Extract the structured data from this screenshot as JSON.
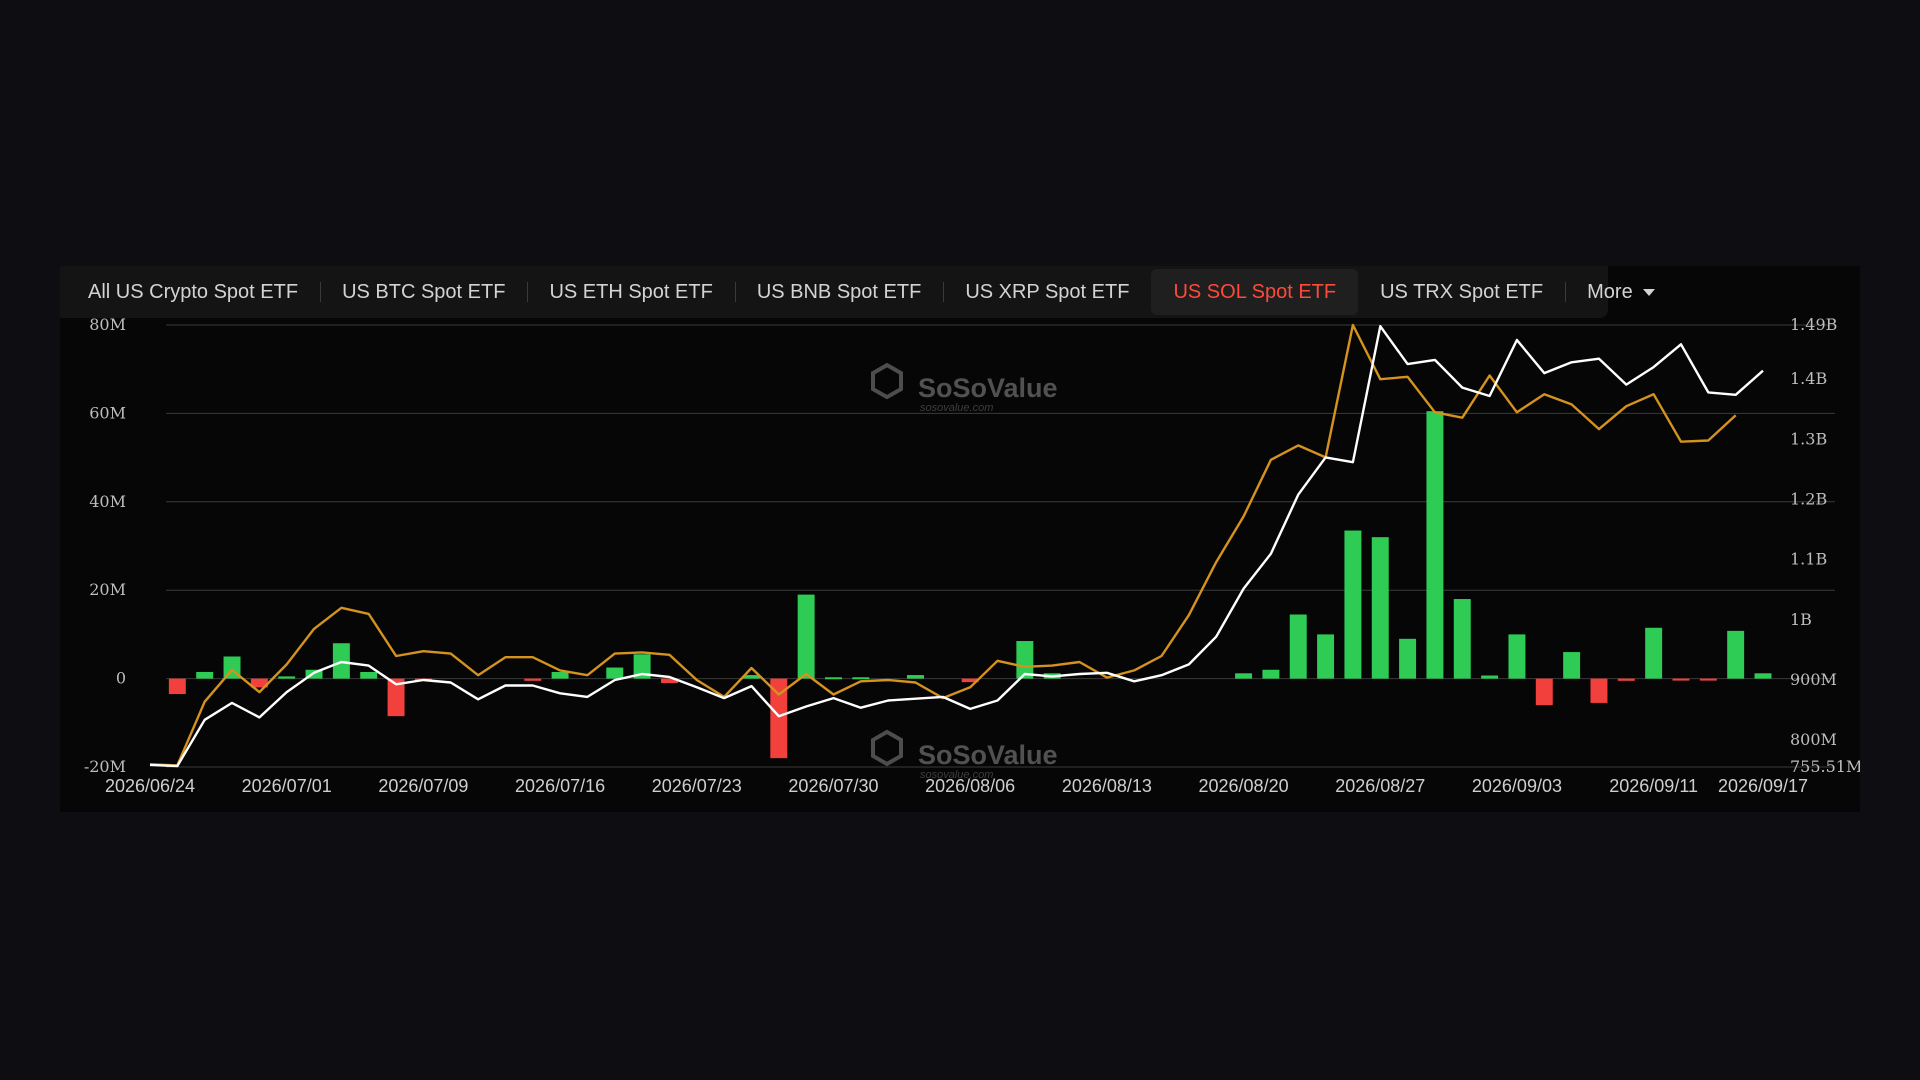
{
  "tabs": [
    {
      "label": "All US Crypto Spot ETF",
      "active": false
    },
    {
      "label": "US BTC Spot ETF",
      "active": false
    },
    {
      "label": "US ETH Spot ETF",
      "active": false
    },
    {
      "label": "US BNB Spot ETF",
      "active": false
    },
    {
      "label": "US XRP Spot ETF",
      "active": false
    },
    {
      "label": "US SOL Spot ETF",
      "active": true
    },
    {
      "label": "US TRX Spot ETF",
      "active": false
    }
  ],
  "more_label": "More",
  "watermark": {
    "brand": "SoSoValue",
    "site": "sosovalue.com"
  },
  "colors": {
    "inflow": "#2ecc55",
    "outflow": "#f2403c",
    "white_line": "#ffffff",
    "gold_line": "#d4921e",
    "accent": "#ff4a3a",
    "grid": "#3a3a3a"
  },
  "chart_data": {
    "type": "bar",
    "left_axis": {
      "ticks": [
        "80M",
        "60M",
        "40M",
        "20M",
        "0",
        "-20M"
      ],
      "values": [
        80,
        60,
        40,
        20,
        0,
        -20
      ],
      "ylim": [
        -20,
        80
      ],
      "unit": "M"
    },
    "right_axis": {
      "ticks": [
        "1.49B",
        "1.4B",
        "1.3B",
        "1.2B",
        "1.1B",
        "1B",
        "900M",
        "800M",
        "755.51M"
      ],
      "values": [
        1490,
        1400,
        1300,
        1200,
        1100,
        1000,
        900,
        800,
        755.51
      ],
      "ylim": [
        755.51,
        1490
      ],
      "unit": "M"
    },
    "x_ticks": [
      {
        "label": "2026/06/24",
        "index": 0
      },
      {
        "label": "2026/07/01",
        "index": 5
      },
      {
        "label": "2026/07/09",
        "index": 10
      },
      {
        "label": "2026/07/16",
        "index": 15
      },
      {
        "label": "2026/07/23",
        "index": 20
      },
      {
        "label": "2026/07/30",
        "index": 25
      },
      {
        "label": "2026/08/06",
        "index": 30
      },
      {
        "label": "2026/08/13",
        "index": 35
      },
      {
        "label": "2026/08/20",
        "index": 40
      },
      {
        "label": "2026/08/27",
        "index": 45
      },
      {
        "label": "2026/09/03",
        "index": 50
      },
      {
        "label": "2026/09/11",
        "index": 55
      },
      {
        "label": "2026/09/17",
        "index": 59
      }
    ],
    "bars": [
      0,
      -3.5,
      1.5,
      5,
      -2,
      0.5,
      2,
      8,
      1.5,
      -8.5,
      -0.5,
      0,
      0,
      0,
      -0.5,
      1.5,
      0,
      2.5,
      5.5,
      -1,
      0,
      0,
      0.8,
      -18,
      19,
      0.3,
      0.3,
      0,
      0.8,
      0,
      -0.8,
      0,
      8.5,
      1.2,
      0,
      0,
      0,
      0,
      0,
      0,
      1.2,
      2,
      14.5,
      10,
      33.5,
      32,
      9,
      60.5,
      18,
      0.7,
      10,
      -6,
      6,
      -5.5,
      -0.5,
      11.5,
      -0.3,
      -0.3,
      10.8,
      1.2,
      0.7
    ],
    "series": [
      {
        "values": [
          759,
          757,
          834,
          862,
          838,
          880,
          912,
          930,
          924,
          893,
          900,
          896,
          868,
          891,
          891,
          878,
          872,
          900,
          910,
          905,
          888,
          870,
          890,
          840,
          856,
          870,
          854,
          866,
          869,
          872,
          852,
          866,
          910,
          906,
          910,
          912,
          898,
          908,
          926,
          972,
          1052,
          1110,
          1208,
          1270,
          1262,
          1488,
          1425,
          1432,
          1386,
          1372,
          1465,
          1410,
          1428,
          1434,
          1391,
          1420,
          1458,
          1378,
          1374,
          1414
        ]
      },
      {
        "values": [
          760,
          758,
          864,
          917,
          880,
          926,
          985,
          1020,
          1010,
          940,
          948,
          944,
          908,
          938,
          938,
          916,
          908,
          944,
          946,
          942,
          900,
          872,
          920,
          876,
          910,
          876,
          898,
          900,
          896,
          870,
          888,
          932,
          922,
          924,
          930,
          904,
          916,
          940,
          1008,
          1096,
          1172,
          1266,
          1290,
          1270,
          1490,
          1400,
          1404,
          1345,
          1336,
          1406,
          1345,
          1375,
          1358,
          1317,
          1355,
          1375,
          1296,
          1298,
          1340
        ]
      }
    ]
  }
}
